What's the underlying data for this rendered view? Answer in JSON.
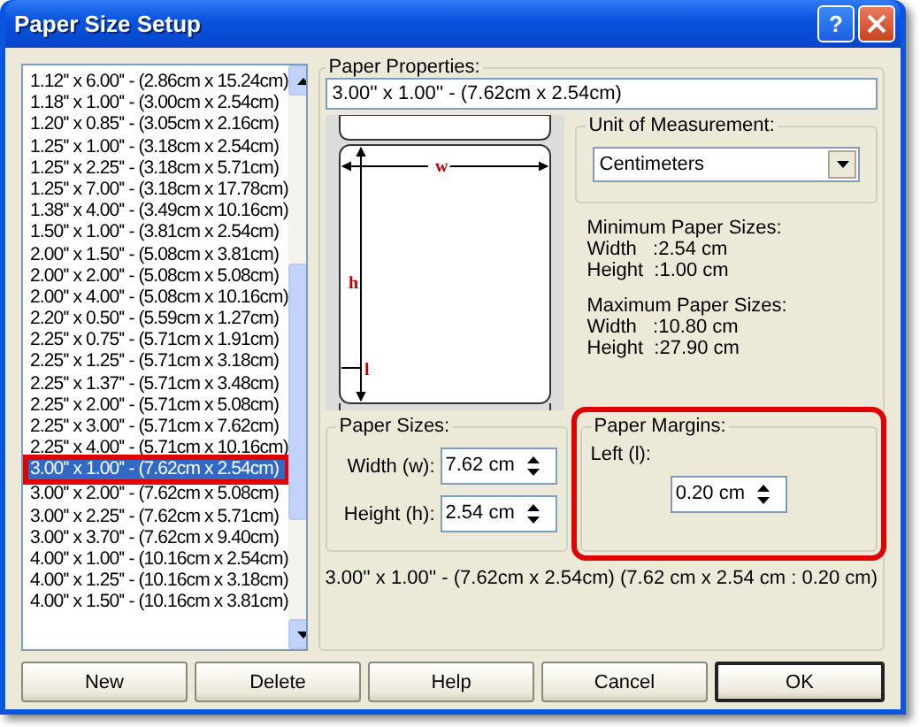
{
  "window": {
    "title": "Paper Size Setup",
    "help_button": "?"
  },
  "sizes_list": {
    "items": [
      {
        "label": "1.12'' x 6.00'' - (2.86cm x 15.24cm)",
        "selected": false
      },
      {
        "label": "1.18'' x 1.00'' - (3.00cm x 2.54cm)",
        "selected": false
      },
      {
        "label": "1.20'' x 0.85'' - (3.05cm x 2.16cm)",
        "selected": false
      },
      {
        "label": "1.25'' x 1.00'' - (3.18cm x 2.54cm)",
        "selected": false
      },
      {
        "label": "1.25'' x 2.25'' - (3.18cm x 5.71cm)",
        "selected": false
      },
      {
        "label": "1.25'' x 7.00'' - (3.18cm x 17.78cm)",
        "selected": false
      },
      {
        "label": "1.38'' x 4.00'' - (3.49cm x 10.16cm)",
        "selected": false
      },
      {
        "label": "1.50'' x 1.00'' - (3.81cm x 2.54cm)",
        "selected": false
      },
      {
        "label": "2.00'' x 1.50'' - (5.08cm x 3.81cm)",
        "selected": false
      },
      {
        "label": "2.00'' x 2.00'' - (5.08cm x 5.08cm)",
        "selected": false
      },
      {
        "label": "2.00'' x 4.00'' - (5.08cm x 10.16cm)",
        "selected": false
      },
      {
        "label": "2.20'' x 0.50'' - (5.59cm x 1.27cm)",
        "selected": false
      },
      {
        "label": "2.25'' x 0.75'' - (5.71cm x 1.91cm)",
        "selected": false
      },
      {
        "label": "2.25'' x 1.25'' - (5.71cm x 3.18cm)",
        "selected": false
      },
      {
        "label": "2.25'' x 1.37'' - (5.71cm x 3.48cm)",
        "selected": false
      },
      {
        "label": "2.25'' x 2.00'' - (5.71cm x 5.08cm)",
        "selected": false
      },
      {
        "label": "2.25'' x 3.00'' - (5.71cm x 7.62cm)",
        "selected": false
      },
      {
        "label": "2.25'' x 4.00'' - (5.71cm x 10.16cm)",
        "selected": false
      },
      {
        "label": "3.00'' x 1.00'' - (7.62cm x 2.54cm)",
        "selected": true,
        "highlighted": true
      },
      {
        "label": "3.00'' x 2.00'' - (7.62cm x 5.08cm)",
        "selected": false
      },
      {
        "label": "3.00'' x 2.25'' - (7.62cm x 5.71cm)",
        "selected": false
      },
      {
        "label": "3.00'' x 3.70'' - (7.62cm x 9.40cm)",
        "selected": false
      },
      {
        "label": "4.00'' x 1.00'' - (10.16cm x 2.54cm)",
        "selected": false
      },
      {
        "label": "4.00'' x 1.25'' - (10.16cm x 3.18cm)",
        "selected": false
      },
      {
        "label": "4.00'' x 1.50'' - (10.16cm x 3.81cm)",
        "selected": false
      }
    ]
  },
  "paper_properties": {
    "title": "Paper Properties:",
    "name_value": "3.00'' x 1.00'' - (7.62cm x 2.54cm)",
    "preview": {
      "width_mark": "w",
      "height_mark": "h",
      "left_mark": "l"
    },
    "unit": {
      "title": "Unit of Measurement:",
      "value": "Centimeters"
    },
    "minimum": {
      "title": "Minimum Paper Sizes:",
      "lines": [
        "Width   :2.54 cm",
        "Height  :1.00 cm"
      ]
    },
    "maximum": {
      "title": "Maximum Paper Sizes:",
      "lines": [
        "Width   :10.80 cm",
        "Height  :27.90 cm"
      ]
    },
    "paper_sizes": {
      "title": "Paper Sizes:",
      "fields": [
        {
          "label": "Width (w):",
          "value": "7.62 cm"
        },
        {
          "label": "Height (h):",
          "value": "2.54 cm"
        }
      ]
    },
    "paper_margins": {
      "title": "Paper Margins:",
      "highlighted": true,
      "label": "Left (l):",
      "value": "0.20 cm"
    },
    "summary": "3.00'' x 1.00'' - (7.62cm x 2.54cm) (7.62 cm x 2.54 cm : 0.20 cm)"
  },
  "buttons": [
    {
      "label": "New",
      "default": false
    },
    {
      "label": "Delete",
      "default": false
    },
    {
      "label": "Help",
      "default": false
    },
    {
      "label": "Cancel",
      "default": false
    },
    {
      "label": "OK",
      "default": true
    }
  ]
}
